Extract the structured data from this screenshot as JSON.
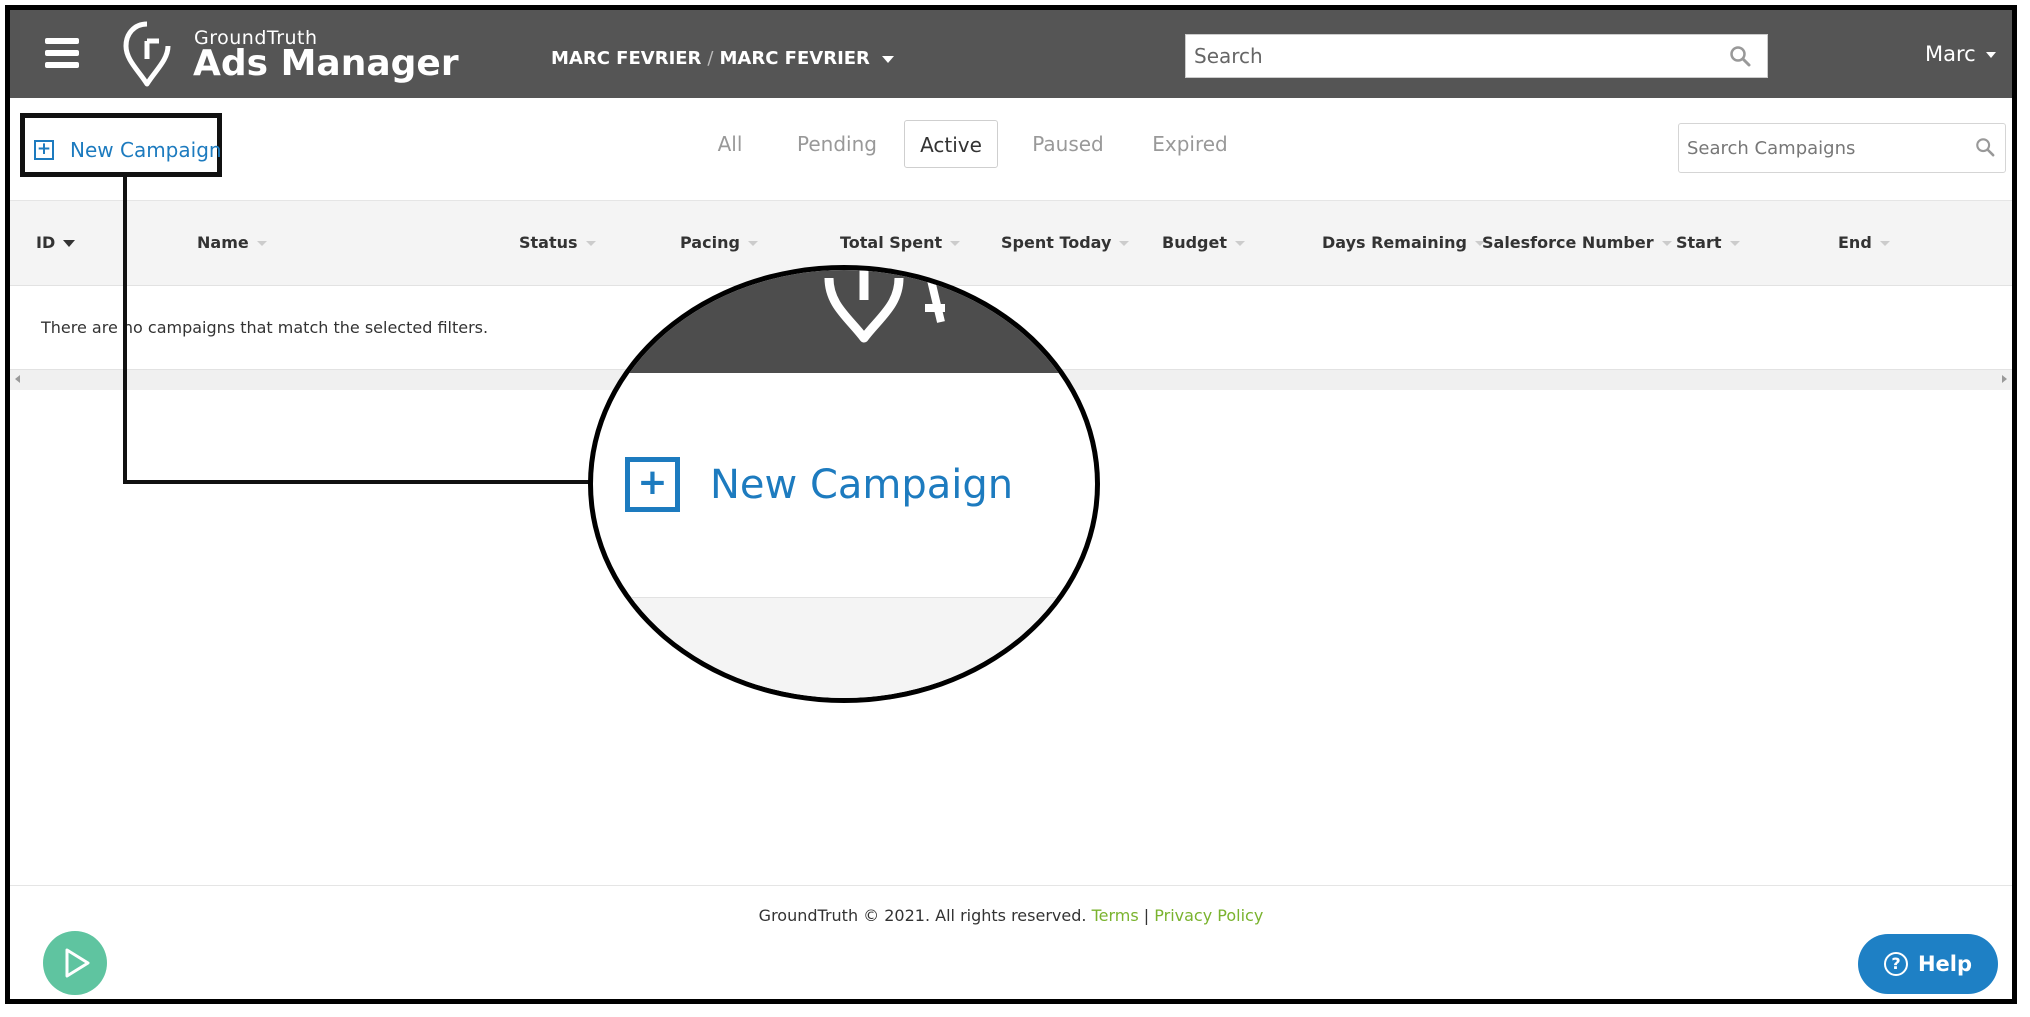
{
  "header": {
    "brand_small": "GroundTruth",
    "brand_big": "Ads Manager",
    "account_primary": "MARC FEVRIER",
    "account_separator": "/",
    "account_secondary": "MARC FEVRIER",
    "search_placeholder": "Search",
    "user": "Marc"
  },
  "toolbar": {
    "new_campaign_label": "New Campaign",
    "tabs": [
      "All",
      "Pending",
      "Active",
      "Paused",
      "Expired"
    ],
    "active_tab": "Active",
    "campaign_search_placeholder": "Search Campaigns"
  },
  "table": {
    "columns": [
      "ID",
      "Name",
      "Status",
      "Pacing",
      "Total Spent",
      "Spent Today",
      "Budget",
      "Days Remaining",
      "Salesforce Number",
      "Start",
      "End"
    ],
    "sorted_column": "ID",
    "empty_message": "There are no campaigns that match the selected filters."
  },
  "callout": {
    "label": "New Campaign"
  },
  "footer": {
    "copyright": "GroundTruth © 2021. All rights reserved.",
    "terms": "Terms",
    "separator": "|",
    "privacy": "Privacy Policy"
  },
  "help_label": "Help",
  "colors": {
    "header_bg": "#555555",
    "link_blue": "#1d7bbf",
    "footer_link_green": "#7ab32e",
    "help_button": "#1e80c5",
    "play_button": "#5fc4a0"
  }
}
